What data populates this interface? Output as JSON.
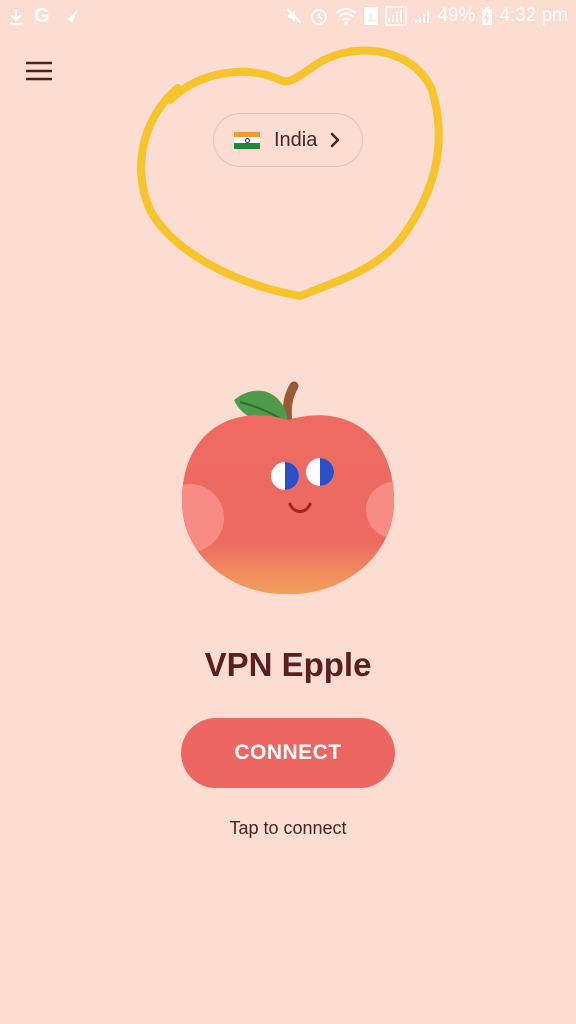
{
  "status_bar": {
    "google_letter": "G",
    "battery_percent": "49%",
    "time": "4:32 pm",
    "text_color": "#ffffff"
  },
  "menu": {
    "icon": "hamburger-menu-icon"
  },
  "country_selector": {
    "country": "India",
    "flag_icon": "india-flag-icon",
    "chevron_icon": "chevron-right-icon"
  },
  "highlight": {
    "color": "#f7c42c"
  },
  "app": {
    "title": "VPN Epple",
    "mascot_icon": "apple-mascot-icon"
  },
  "connect": {
    "label": "CONNECT",
    "hint": "Tap to connect",
    "button_color": "#ec6762"
  },
  "colors": {
    "background": "#fddcd2",
    "title": "#5b1f1c",
    "text": "#4a2523"
  }
}
